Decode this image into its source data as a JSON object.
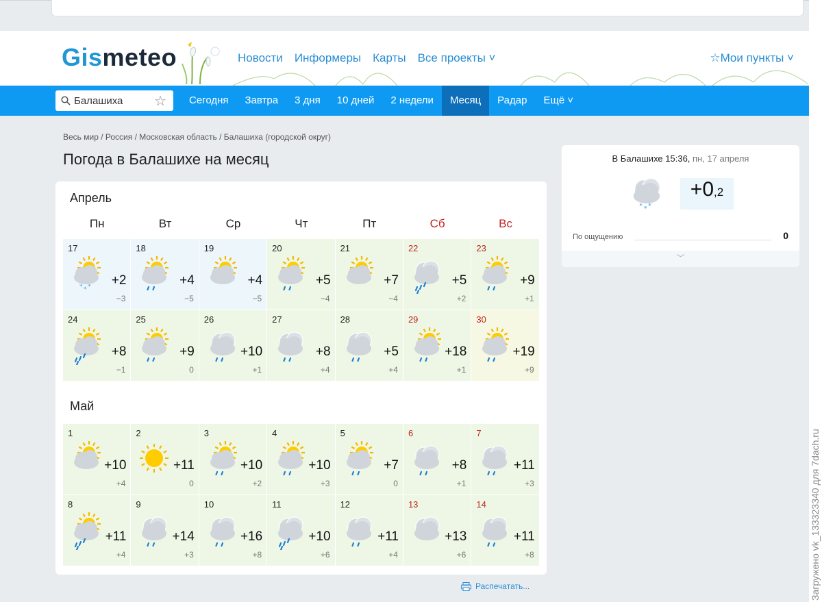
{
  "header": {
    "logo_part1": "Gis",
    "logo_part2": "meteo",
    "nav": [
      "Новости",
      "Информеры",
      "Карты",
      "Все проекты ˅"
    ],
    "my_points": "☆Мои пункты ˅"
  },
  "navbar": {
    "search_value": "Балашиха",
    "items": [
      "Сегодня",
      "Завтра",
      "3 дня",
      "10 дней",
      "2 недели",
      "Месяц",
      "Радар",
      "Ещё ˅"
    ],
    "active_index": 5
  },
  "breadcrumb": "Весь мир  /  Россия  /  Московская область  /  Балашиха (городской округ)",
  "title": "Погода в Балашихе на месяц",
  "weekdays": [
    "Пн",
    "Вт",
    "Ср",
    "Чт",
    "Пт",
    "Сб",
    "Вс"
  ],
  "months": [
    {
      "name": "Апрель",
      "days": [
        {
          "d": "17",
          "max": "+2",
          "min": "−3",
          "icon": "sun-cloud-snow"
        },
        {
          "d": "18",
          "max": "+4",
          "min": "−5",
          "icon": "sun-cloud-rain"
        },
        {
          "d": "19",
          "max": "+4",
          "min": "−5",
          "icon": "sun-cloud"
        },
        {
          "d": "20",
          "max": "+5",
          "min": "−4",
          "icon": "sun-cloud-rain"
        },
        {
          "d": "21",
          "max": "+7",
          "min": "−4",
          "icon": "sun-cloud"
        },
        {
          "d": "22",
          "max": "+5",
          "min": "+2",
          "icon": "cloud-heavy-rain"
        },
        {
          "d": "23",
          "max": "+9",
          "min": "+1",
          "icon": "sun-cloud-rain"
        },
        {
          "d": "24",
          "max": "+8",
          "min": "−1",
          "icon": "sun-cloud-heavy-rain"
        },
        {
          "d": "25",
          "max": "+9",
          "min": "0",
          "icon": "sun-cloud-rain"
        },
        {
          "d": "26",
          "max": "+10",
          "min": "+1",
          "icon": "cloud-rain"
        },
        {
          "d": "27",
          "max": "+8",
          "min": "+4",
          "icon": "cloud-rain"
        },
        {
          "d": "28",
          "max": "+5",
          "min": "+4",
          "icon": "cloud-rain"
        },
        {
          "d": "29",
          "max": "+18",
          "min": "+1",
          "icon": "sun-cloud-rain"
        },
        {
          "d": "30",
          "max": "+19",
          "min": "+9",
          "icon": "sun-cloud-rain"
        }
      ]
    },
    {
      "name": "Май",
      "days": [
        {
          "d": "1",
          "max": "+10",
          "min": "+4",
          "icon": "sun-cloud"
        },
        {
          "d": "2",
          "max": "+11",
          "min": "0",
          "icon": "sun"
        },
        {
          "d": "3",
          "max": "+10",
          "min": "+2",
          "icon": "sun-cloud-rain"
        },
        {
          "d": "4",
          "max": "+10",
          "min": "+3",
          "icon": "sun-cloud-rain"
        },
        {
          "d": "5",
          "max": "+7",
          "min": "0",
          "icon": "sun-cloud-rain"
        },
        {
          "d": "6",
          "max": "+8",
          "min": "+1",
          "icon": "cloud-rain"
        },
        {
          "d": "7",
          "max": "+11",
          "min": "+3",
          "icon": "cloud-rain"
        },
        {
          "d": "8",
          "max": "+11",
          "min": "+4",
          "icon": "sun-cloud-heavy-rain"
        },
        {
          "d": "9",
          "max": "+14",
          "min": "+3",
          "icon": "cloud-rain"
        },
        {
          "d": "10",
          "max": "+16",
          "min": "+8",
          "icon": "cloud-rain"
        },
        {
          "d": "11",
          "max": "+10",
          "min": "+6",
          "icon": "cloud-heavy-rain"
        },
        {
          "d": "12",
          "max": "+11",
          "min": "+4",
          "icon": "cloud-rain"
        },
        {
          "d": "13",
          "max": "+13",
          "min": "+6",
          "icon": "cloud"
        },
        {
          "d": "14",
          "max": "+11",
          "min": "+8",
          "icon": "cloud-rain"
        }
      ]
    }
  ],
  "print_label": "Распечатать...",
  "current": {
    "place": "В Балашихе 15:36,",
    "date": " пн, 17 апреля",
    "temp_big": "+0",
    "temp_small": ",2",
    "feels_label": "По ощущению",
    "feels_value": "0",
    "icon": "cloud-snow"
  },
  "watermark": "Загружено vk_133323340 для 7dach.ru",
  "colors": {
    "accent": "#0e9af2",
    "active_tab": "#0d6fba",
    "weekend": "#c0261f",
    "cell_sunny_green": "#eef7e6",
    "cell_cold_blue": "#edf6fb",
    "cell_warm_yellow": "#f6f8e3"
  }
}
